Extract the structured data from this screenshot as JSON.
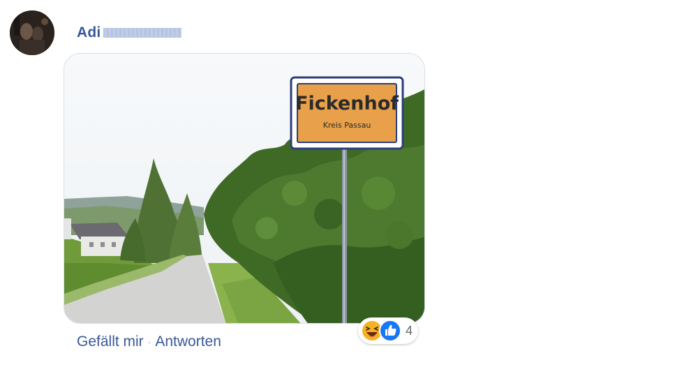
{
  "comment": {
    "author": {
      "name": "Adi"
    },
    "image": {
      "sign": {
        "title": "Fickenhof",
        "subtitle": "Kreis Passau"
      }
    },
    "actions": {
      "like_label": "Gefällt mir",
      "separator": "·",
      "reply_label": "Antworten"
    },
    "reactions": {
      "icons": [
        "haha-icon",
        "like-icon"
      ],
      "count": "4"
    }
  },
  "colors": {
    "link_blue": "#385898",
    "like_blue": "#1877f2",
    "haha_yellow": "#f7b125",
    "sign_orange": "#e8a04a",
    "muted_gray": "#65676b"
  }
}
